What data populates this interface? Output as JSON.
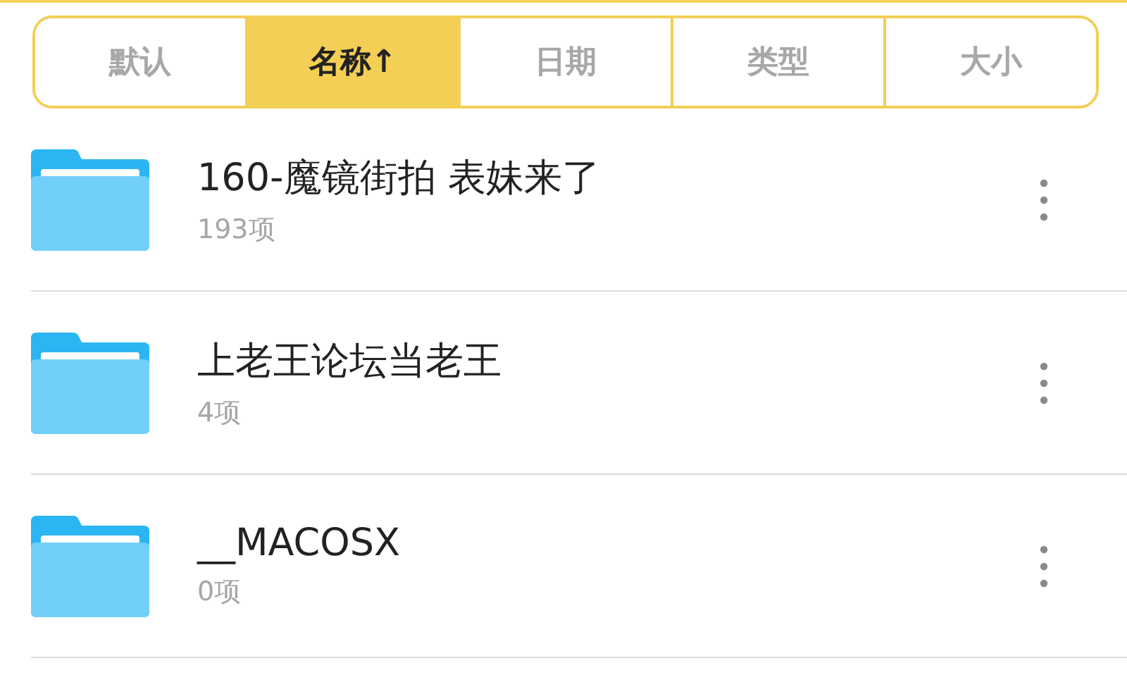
{
  "sort_tabs": [
    {
      "label": "默认",
      "selected": false
    },
    {
      "label": "名称↑",
      "selected": true
    },
    {
      "label": "日期",
      "selected": false
    },
    {
      "label": "类型",
      "selected": false
    },
    {
      "label": "大小",
      "selected": false
    }
  ],
  "folders": [
    {
      "name": "160-魔镜街拍 表妹来了",
      "count": "193项"
    },
    {
      "name": "上老王论坛当老王",
      "count": "4项"
    },
    {
      "name": "__MACOSX",
      "count": "0项"
    }
  ]
}
